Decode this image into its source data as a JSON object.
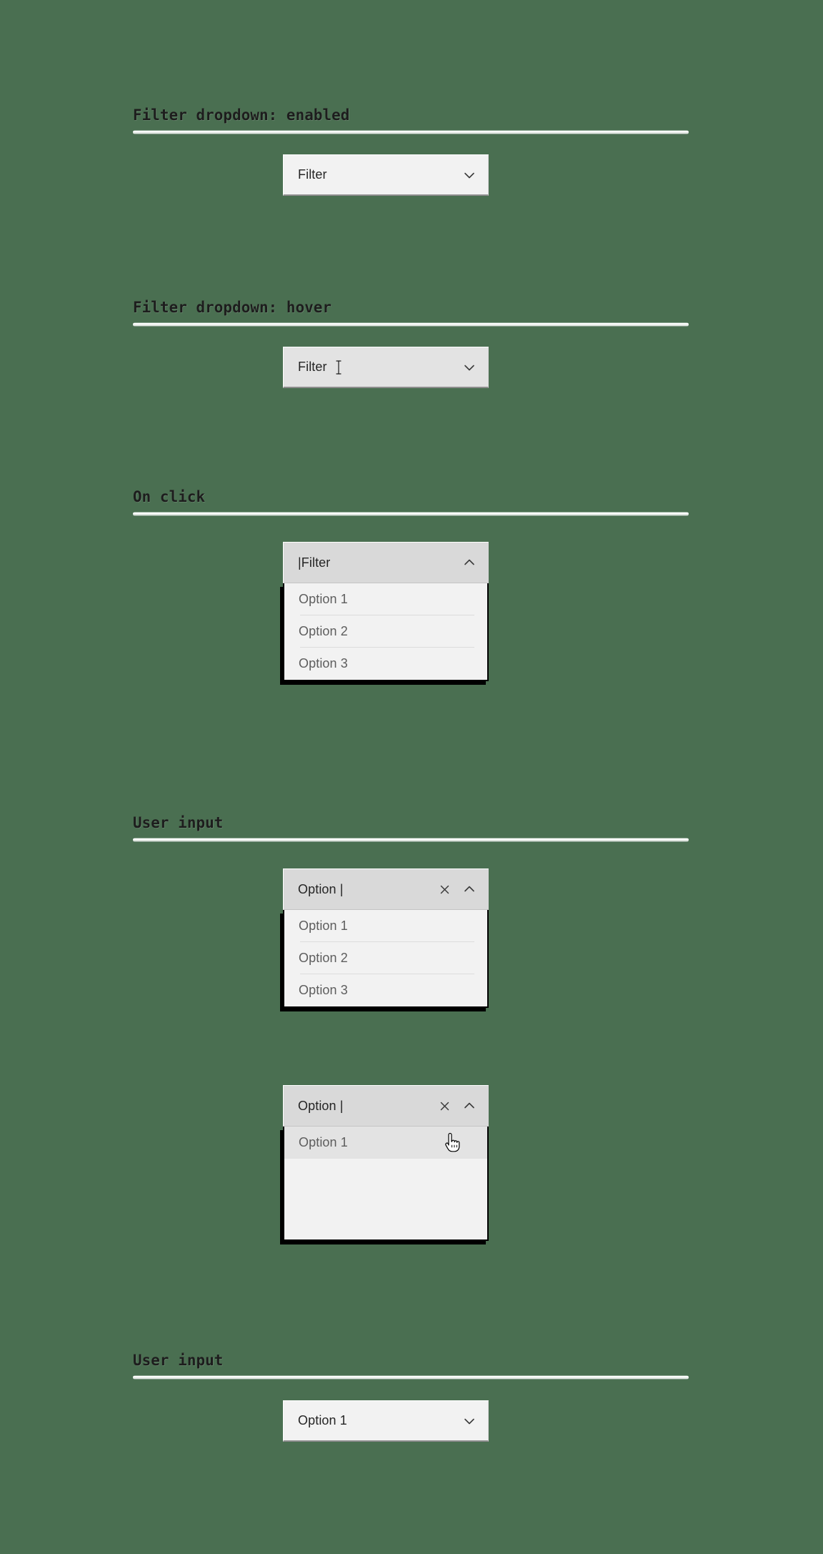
{
  "page": {
    "background_color": "#4a6f51",
    "surface_color": "#f2f2f2",
    "hover_color": "#e3e3e3",
    "open_color": "#d9d9d9",
    "text_color": "#252525",
    "option_text_color": "#5d5d5d",
    "shadow_color": "#000000"
  },
  "sections": {
    "enabled": {
      "title": "Filter dropdown: enabled"
    },
    "hover": {
      "title": "Filter dropdown: hover"
    },
    "onclick": {
      "title": "On click"
    },
    "user_input": {
      "title": "User input"
    },
    "user_input_result": {
      "title": "User input"
    }
  },
  "dropdowns": {
    "enabled": {
      "value": "Filter",
      "chevron": "chevron-down-icon",
      "state": "enabled"
    },
    "hover": {
      "value": "Filter",
      "chevron": "chevron-down-icon",
      "cursor": "text-ibeam-cursor",
      "state": "hover"
    },
    "open": {
      "value": "|Filter",
      "chevron": "chevron-up-icon",
      "state": "open",
      "options": [
        "Option 1",
        "Option 2",
        "Option 3"
      ]
    },
    "typed": {
      "value": "Option |",
      "clear": "close-icon",
      "chevron": "chevron-up-icon",
      "state": "open",
      "options": [
        "Option 1",
        "Option 2",
        "Option 3"
      ]
    },
    "filtered": {
      "value": "Option |",
      "clear": "close-icon",
      "chevron": "chevron-up-icon",
      "state": "open",
      "cursor": "pointer-hand-cursor",
      "options": [
        "Option 1"
      ],
      "highlighted_index": 0
    },
    "selected": {
      "value": "Option 1",
      "chevron": "chevron-down-icon",
      "state": "enabled"
    }
  }
}
